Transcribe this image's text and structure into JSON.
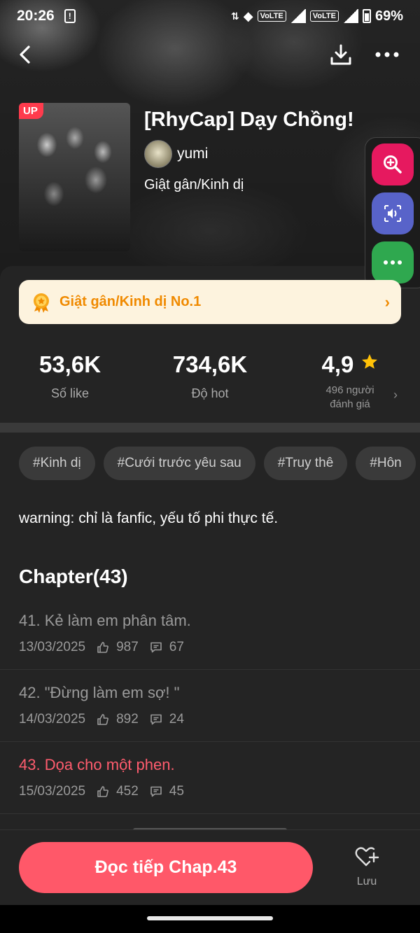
{
  "status_bar": {
    "time": "20:26",
    "battery": "69%",
    "volte1": "VoLTE",
    "volte2": "VoLTE"
  },
  "book": {
    "badge": "UP",
    "title": "[RhyCap] Dạy Chồng!",
    "author": "yumi",
    "genre": "Giật gân/Kinh dị"
  },
  "rank": {
    "label": "Giật gân/Kinh dị No.1"
  },
  "stats": {
    "likes": {
      "value": "53,6K",
      "label": "Số like"
    },
    "hot": {
      "value": "734,6K",
      "label": "Độ hot"
    },
    "rating": {
      "value": "4,9",
      "label_line1": "496 người",
      "label_line2": "đánh giá"
    }
  },
  "tags": [
    "#Kinh dị",
    "#Cưới trước yêu sau",
    "#Truy thê",
    "#Hôn"
  ],
  "description": "warning: chỉ là fanfic, yếu tố phi thực tế.",
  "chapters_heading": "Chapter(43)",
  "chapters": [
    {
      "title": "41. Kẻ làm em phân tâm.",
      "date": "13/03/2025",
      "likes": "987",
      "comments": "67"
    },
    {
      "title": "42. \"Đừng làm em sợ! \"",
      "date": "14/03/2025",
      "likes": "892",
      "comments": "24"
    },
    {
      "title": "43. Dọa cho một phen.",
      "date": "15/03/2025",
      "likes": "452",
      "comments": "45"
    }
  ],
  "cta": {
    "read_label": "Đọc tiếp Chap.43",
    "save_label": "Lưu"
  },
  "colors": {
    "accent": "#ff5869",
    "rank_text": "#f08a00",
    "tool_zoom": "#e6195f",
    "tool_audio": "#5863c9",
    "tool_more": "#2fa84f"
  },
  "icons": [
    "back-arrow-icon",
    "download-icon",
    "more-dots-icon",
    "zoom-icon",
    "audio-icon",
    "chat-dots-icon",
    "medal-icon",
    "chevron-right-icon",
    "star-icon",
    "thumb-up-icon",
    "comment-icon",
    "heart-plus-icon"
  ]
}
